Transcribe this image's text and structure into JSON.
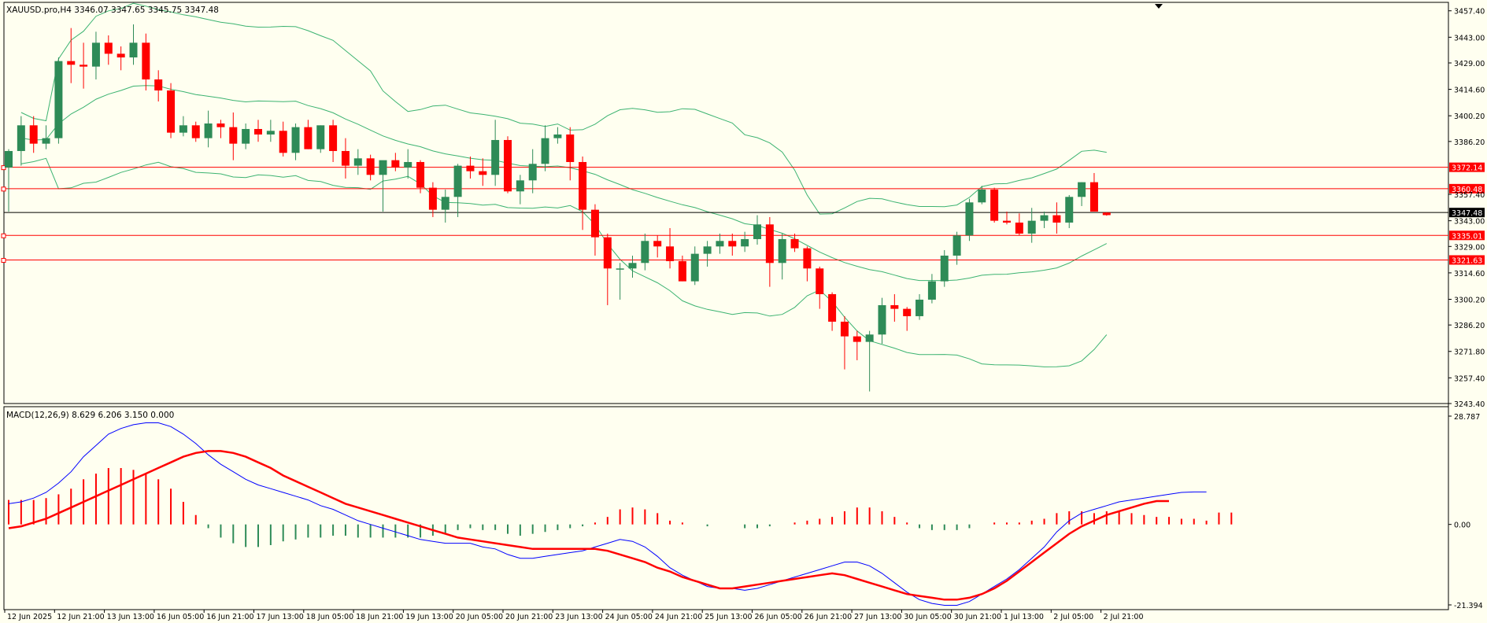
{
  "header": {
    "symbol_line": "XAUUSD.pro,H4  3346.07 3347.65 3345.75 3347.48",
    "macd_line": "MACD(12,26,9) 8.629 6.206 3.150 0.000"
  },
  "colors": {
    "background": "#fffff0",
    "bull": "#2e8b57",
    "bear": "#ff0000",
    "bands": "#3cb371",
    "levels": "#ff0000",
    "current": "#000000",
    "macd_main": "#0000ff",
    "macd_signal": "#ff0000"
  },
  "chart_data": [
    {
      "type": "candlestick",
      "title": "XAUUSD.pro,H4  3346.07 3347.65 3345.75 3347.48",
      "ylim": [
        3243.4,
        3462.0
      ],
      "y_ticks": [
        "3457.40",
        "3443.00",
        "3429.00",
        "3414.60",
        "3400.20",
        "3386.20",
        "3357.40",
        "3343.00",
        "3329.00",
        "3314.60",
        "3300.20",
        "3286.20",
        "3271.80",
        "3257.40",
        "3243.40"
      ],
      "x_labels": [
        "12 Jun 2025",
        "12 Jun 21:00",
        "13 Jun 13:00",
        "16 Jun 05:00",
        "16 Jun 21:00",
        "17 Jun 13:00",
        "18 Jun 05:00",
        "18 Jun 21:00",
        "19 Jun 13:00",
        "20 Jun 05:00",
        "20 Jun 21:00",
        "23 Jun 13:00",
        "24 Jun 05:00",
        "24 Jun 21:00",
        "25 Jun 13:00",
        "26 Jun 05:00",
        "26 Jun 21:00",
        "27 Jun 13:00",
        "30 Jun 05:00",
        "30 Jun 21:00",
        "1 Jul 13:00",
        "2 Jul 05:00",
        "2 Jul 21:00"
      ],
      "horizontal_levels": [
        {
          "value": 3372.14,
          "label": "3372.14"
        },
        {
          "value": 3360.48,
          "label": "3360.48"
        },
        {
          "value": 3335.01,
          "label": "3335.01"
        },
        {
          "value": 3321.63,
          "label": "3321.63"
        }
      ],
      "current_price": {
        "value": 3347.48,
        "label": "3347.48"
      },
      "candles": [
        [
          3372,
          3382,
          3348,
          3381
        ],
        [
          3381,
          3400,
          3373,
          3395
        ],
        [
          3395,
          3400,
          3380,
          3385
        ],
        [
          3385,
          3395,
          3382,
          3388
        ],
        [
          3388,
          3432,
          3385,
          3430
        ],
        [
          3430,
          3448,
          3418,
          3428
        ],
        [
          3428,
          3440,
          3415,
          3427
        ],
        [
          3427,
          3446,
          3420,
          3440
        ],
        [
          3440,
          3444,
          3428,
          3434
        ],
        [
          3434,
          3438,
          3425,
          3432
        ],
        [
          3432,
          3450,
          3428,
          3440
        ],
        [
          3440,
          3445,
          3414,
          3420
        ],
        [
          3420,
          3425,
          3408,
          3414
        ],
        [
          3414,
          3418,
          3388,
          3391
        ],
        [
          3391,
          3400,
          3389,
          3395
        ],
        [
          3395,
          3397,
          3386,
          3388
        ],
        [
          3388,
          3403,
          3383,
          3396
        ],
        [
          3396,
          3398,
          3388,
          3394
        ],
        [
          3394,
          3402,
          3376,
          3385
        ],
        [
          3385,
          3396,
          3382,
          3393
        ],
        [
          3393,
          3398,
          3386,
          3390
        ],
        [
          3390,
          3398,
          3386,
          3392
        ],
        [
          3392,
          3397,
          3378,
          3380
        ],
        [
          3380,
          3396,
          3376,
          3394
        ],
        [
          3394,
          3398,
          3382,
          3382
        ],
        [
          3382,
          3395,
          3380,
          3395
        ],
        [
          3395,
          3398,
          3375,
          3381
        ],
        [
          3381,
          3388,
          3366,
          3373
        ],
        [
          3373,
          3382,
          3368,
          3377
        ],
        [
          3377,
          3379,
          3365,
          3368
        ],
        [
          3368,
          3374,
          3348,
          3376
        ],
        [
          3376,
          3380,
          3370,
          3372
        ],
        [
          3372,
          3382,
          3366,
          3375
        ],
        [
          3375,
          3376,
          3358,
          3361
        ],
        [
          3361,
          3364,
          3345,
          3349
        ],
        [
          3349,
          3360,
          3342,
          3356
        ],
        [
          3356,
          3374,
          3345,
          3373
        ],
        [
          3373,
          3378,
          3366,
          3370
        ],
        [
          3370,
          3377,
          3362,
          3368
        ],
        [
          3368,
          3398,
          3362,
          3387
        ],
        [
          3387,
          3389,
          3358,
          3359
        ],
        [
          3359,
          3368,
          3352,
          3365
        ],
        [
          3365,
          3382,
          3358,
          3374
        ],
        [
          3374,
          3395,
          3370,
          3388
        ],
        [
          3388,
          3394,
          3385,
          3390
        ],
        [
          3390,
          3394,
          3365,
          3375
        ],
        [
          3375,
          3378,
          3338,
          3349
        ],
        [
          3349,
          3352,
          3324,
          3334
        ],
        [
          3334,
          3336,
          3297,
          3317
        ],
        [
          3317,
          3320,
          3300,
          3317
        ],
        [
          3317,
          3324,
          3312,
          3320
        ],
        [
          3320,
          3336,
          3316,
          3332
        ],
        [
          3332,
          3335,
          3323,
          3329
        ],
        [
          3329,
          3339,
          3317,
          3321
        ],
        [
          3321,
          3324,
          3310,
          3310
        ],
        [
          3310,
          3329,
          3308,
          3325
        ],
        [
          3325,
          3332,
          3318,
          3329
        ],
        [
          3329,
          3336,
          3325,
          3332
        ],
        [
          3332,
          3336,
          3324,
          3329
        ],
        [
          3329,
          3337,
          3326,
          3333
        ],
        [
          3333,
          3346,
          3330,
          3341
        ],
        [
          3341,
          3345,
          3307,
          3320
        ],
        [
          3320,
          3336,
          3311,
          3333
        ],
        [
          3333,
          3336,
          3326,
          3328
        ],
        [
          3328,
          3329,
          3310,
          3317
        ],
        [
          3317,
          3318,
          3295,
          3303
        ],
        [
          3303,
          3304,
          3283,
          3288
        ],
        [
          3288,
          3291,
          3262,
          3280
        ],
        [
          3280,
          3283,
          3267,
          3277
        ],
        [
          3277,
          3283,
          3250,
          3281
        ],
        [
          3281,
          3301,
          3276,
          3297
        ],
        [
          3297,
          3303,
          3288,
          3295
        ],
        [
          3295,
          3296,
          3283,
          3291
        ],
        [
          3291,
          3303,
          3289,
          3300
        ],
        [
          3300,
          3314,
          3298,
          3310
        ],
        [
          3310,
          3327,
          3307,
          3324
        ],
        [
          3324,
          3337,
          3319,
          3335
        ],
        [
          3335,
          3355,
          3332,
          3353
        ],
        [
          3353,
          3362,
          3352,
          3360
        ],
        [
          3360,
          3361,
          3342,
          3343
        ],
        [
          3343,
          3348,
          3341,
          3342
        ],
        [
          3342,
          3347,
          3335,
          3336
        ],
        [
          3336,
          3350,
          3331,
          3343
        ],
        [
          3343,
          3348,
          3339,
          3346
        ],
        [
          3346,
          3353,
          3336,
          3342
        ],
        [
          3342,
          3357,
          3339,
          3356
        ],
        [
          3356,
          3364,
          3351,
          3364
        ],
        [
          3364,
          3369,
          3348,
          3348
        ],
        [
          3347.48,
          3347.65,
          3345.75,
          3346.07
        ]
      ]
    },
    {
      "type": "macd",
      "title": "MACD(12,26,9) 8.629 6.206 3.150 0.000",
      "ylim": [
        -21.394,
        28.787
      ],
      "y_ticks": [
        "28.787",
        "0.00",
        "-21.394"
      ],
      "series": [
        {
          "name": "MACD(12,26,9)",
          "values": [
            5.5,
            6.0,
            7.0,
            8.5,
            11.0,
            14.0,
            18.0,
            21.0,
            24.0,
            25.5,
            26.5,
            27.0,
            27.0,
            26.0,
            24.0,
            21.5,
            18.5,
            16.0,
            14.0,
            12.0,
            10.5,
            9.5,
            8.5,
            7.5,
            6.5,
            5.0,
            4.0,
            2.5,
            1.0,
            0.0,
            -1.0,
            -2.0,
            -3.0,
            -4.0,
            -4.5,
            -5.0,
            -5.0,
            -5.0,
            -6.0,
            -6.5,
            -8.0,
            -9.0,
            -9.0,
            -8.5,
            -8.0,
            -7.5,
            -7.0,
            -6.0,
            -5.0,
            -4.0,
            -4.5,
            -6.0,
            -8.5,
            -11.5,
            -13.5,
            -15.0,
            -16.5,
            -17.0,
            -17.0,
            -17.5,
            -17.0,
            -16.0,
            -15.0,
            -14.0,
            -13.0,
            -12.0,
            -11.0,
            -10.0,
            -10.0,
            -11.0,
            -13.0,
            -15.5,
            -18.0,
            -20.0,
            -21.0,
            -21.5,
            -21.5,
            -20.5,
            -18.5,
            -16.5,
            -14.5,
            -12.0,
            -9.0,
            -6.0,
            -2.0,
            1.0,
            3.0,
            4.0,
            5.0,
            6.0,
            6.5,
            7.0,
            7.5,
            8.0,
            8.5,
            8.629,
            8.629
          ]
        },
        {
          "name": "Signal",
          "values": [
            -1.0,
            -0.5,
            0.5,
            1.5,
            3.0,
            4.5,
            6.0,
            7.5,
            9.0,
            10.5,
            12.0,
            13.5,
            15.0,
            16.5,
            18.0,
            19.0,
            19.5,
            19.5,
            19.0,
            18.0,
            16.5,
            15.0,
            13.0,
            11.5,
            10.0,
            8.5,
            7.0,
            5.5,
            4.5,
            3.5,
            2.5,
            1.5,
            0.5,
            -0.5,
            -1.5,
            -2.5,
            -3.5,
            -4.0,
            -4.5,
            -5.0,
            -5.5,
            -6.0,
            -6.5,
            -6.5,
            -6.5,
            -6.5,
            -6.5,
            -6.5,
            -7.0,
            -8.0,
            -9.0,
            -10.0,
            -11.5,
            -12.5,
            -14.0,
            -15.0,
            -16.0,
            -17.0,
            -17.0,
            -16.5,
            -16.0,
            -15.5,
            -15.0,
            -14.5,
            -14.0,
            -13.5,
            -13.0,
            -13.5,
            -14.5,
            -15.5,
            -16.5,
            -17.5,
            -18.5,
            -19.0,
            -19.5,
            -20.0,
            -20.0,
            -19.5,
            -18.5,
            -17.0,
            -15.0,
            -12.5,
            -10.0,
            -7.5,
            -5.0,
            -2.5,
            -0.5,
            1.0,
            2.5,
            3.5,
            4.5,
            5.5,
            6.2,
            6.206
          ]
        },
        {
          "name": "Histogram",
          "values": [
            6.5,
            6.5,
            6.5,
            7.0,
            8.0,
            9.5,
            12.0,
            13.5,
            15.0,
            15.0,
            14.5,
            13.5,
            12.0,
            9.5,
            6.0,
            2.5,
            -1.0,
            -3.5,
            -5.0,
            -6.0,
            -6.0,
            -5.5,
            -4.5,
            -4.0,
            -3.5,
            -3.5,
            -3.0,
            -3.0,
            -3.5,
            -3.5,
            -3.5,
            -3.5,
            -3.5,
            -3.5,
            -3.0,
            -2.5,
            -1.5,
            -1.0,
            -1.5,
            -1.5,
            -2.5,
            -3.0,
            -2.5,
            -2.0,
            -1.5,
            -1.0,
            -0.5,
            0.5,
            2.0,
            4.0,
            4.5,
            4.0,
            3.0,
            1.0,
            0.5,
            0.0,
            -0.5,
            0.0,
            0.0,
            -1.0,
            -1.0,
            -0.5,
            0.0,
            0.5,
            1.0,
            1.5,
            2.0,
            3.5,
            4.5,
            4.5,
            3.5,
            2.0,
            0.5,
            -1.0,
            -1.5,
            -1.5,
            -1.5,
            -1.0,
            0.0,
            0.5,
            0.5,
            0.5,
            1.0,
            1.5,
            3.0,
            3.5,
            3.5,
            3.0,
            3.5,
            3.5,
            3.0,
            2.5,
            2.0,
            2.0,
            1.5,
            1.5,
            1.0,
            3.15,
            3.15
          ]
        }
      ]
    }
  ]
}
